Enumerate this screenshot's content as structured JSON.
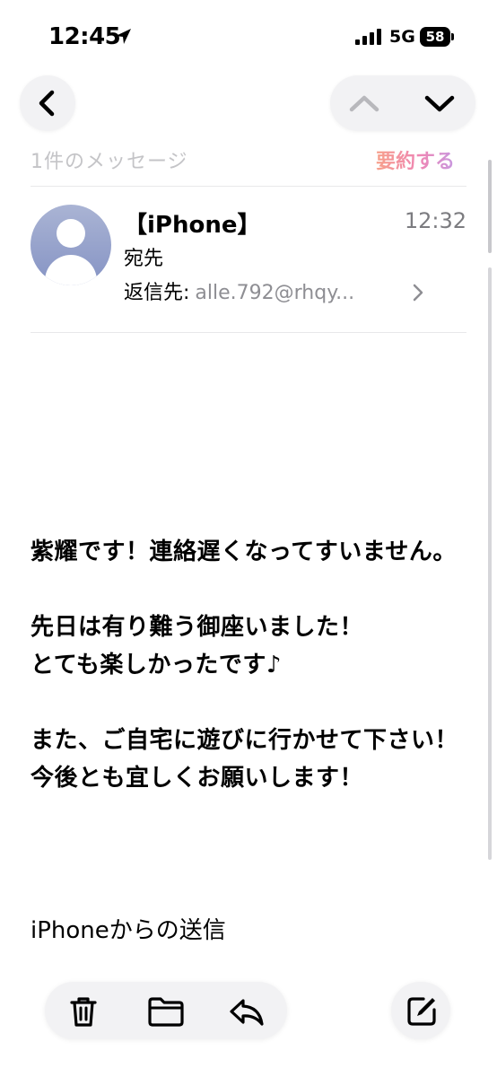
{
  "status_bar": {
    "time": "12:45",
    "network": "5G",
    "battery": "58"
  },
  "nav": {
    "back_icon": "chevron-left-icon",
    "prev_icon": "chevron-up-icon",
    "next_icon": "chevron-down-icon"
  },
  "header": {
    "message_count": "1件のメッセージ",
    "summarize_label": "要約する"
  },
  "mail": {
    "sender": "【iPhone】",
    "time": "12:32",
    "to_label": "宛先",
    "reply_to_label": "返信先:",
    "reply_to_address": "alle.792@rhqy..."
  },
  "body": {
    "lines": [
      "紫耀です！連絡遅くなってすいません。",
      "先日は有り難う御座いました！",
      "とても楽しかったです♪",
      "また、ご自宅に遊びに行かせて下さい！",
      "今後とも宜しくお願いします！"
    ],
    "signature": "iPhoneからの送信"
  },
  "toolbar": {
    "trash_icon": "trash-icon",
    "folder_icon": "folder-icon",
    "reply_icon": "reply-icon",
    "compose_icon": "compose-icon"
  },
  "colors": {
    "secondary_text": "#8e8e93",
    "divider": "#e8e8ea",
    "button_bg": "#f2f2f4"
  }
}
